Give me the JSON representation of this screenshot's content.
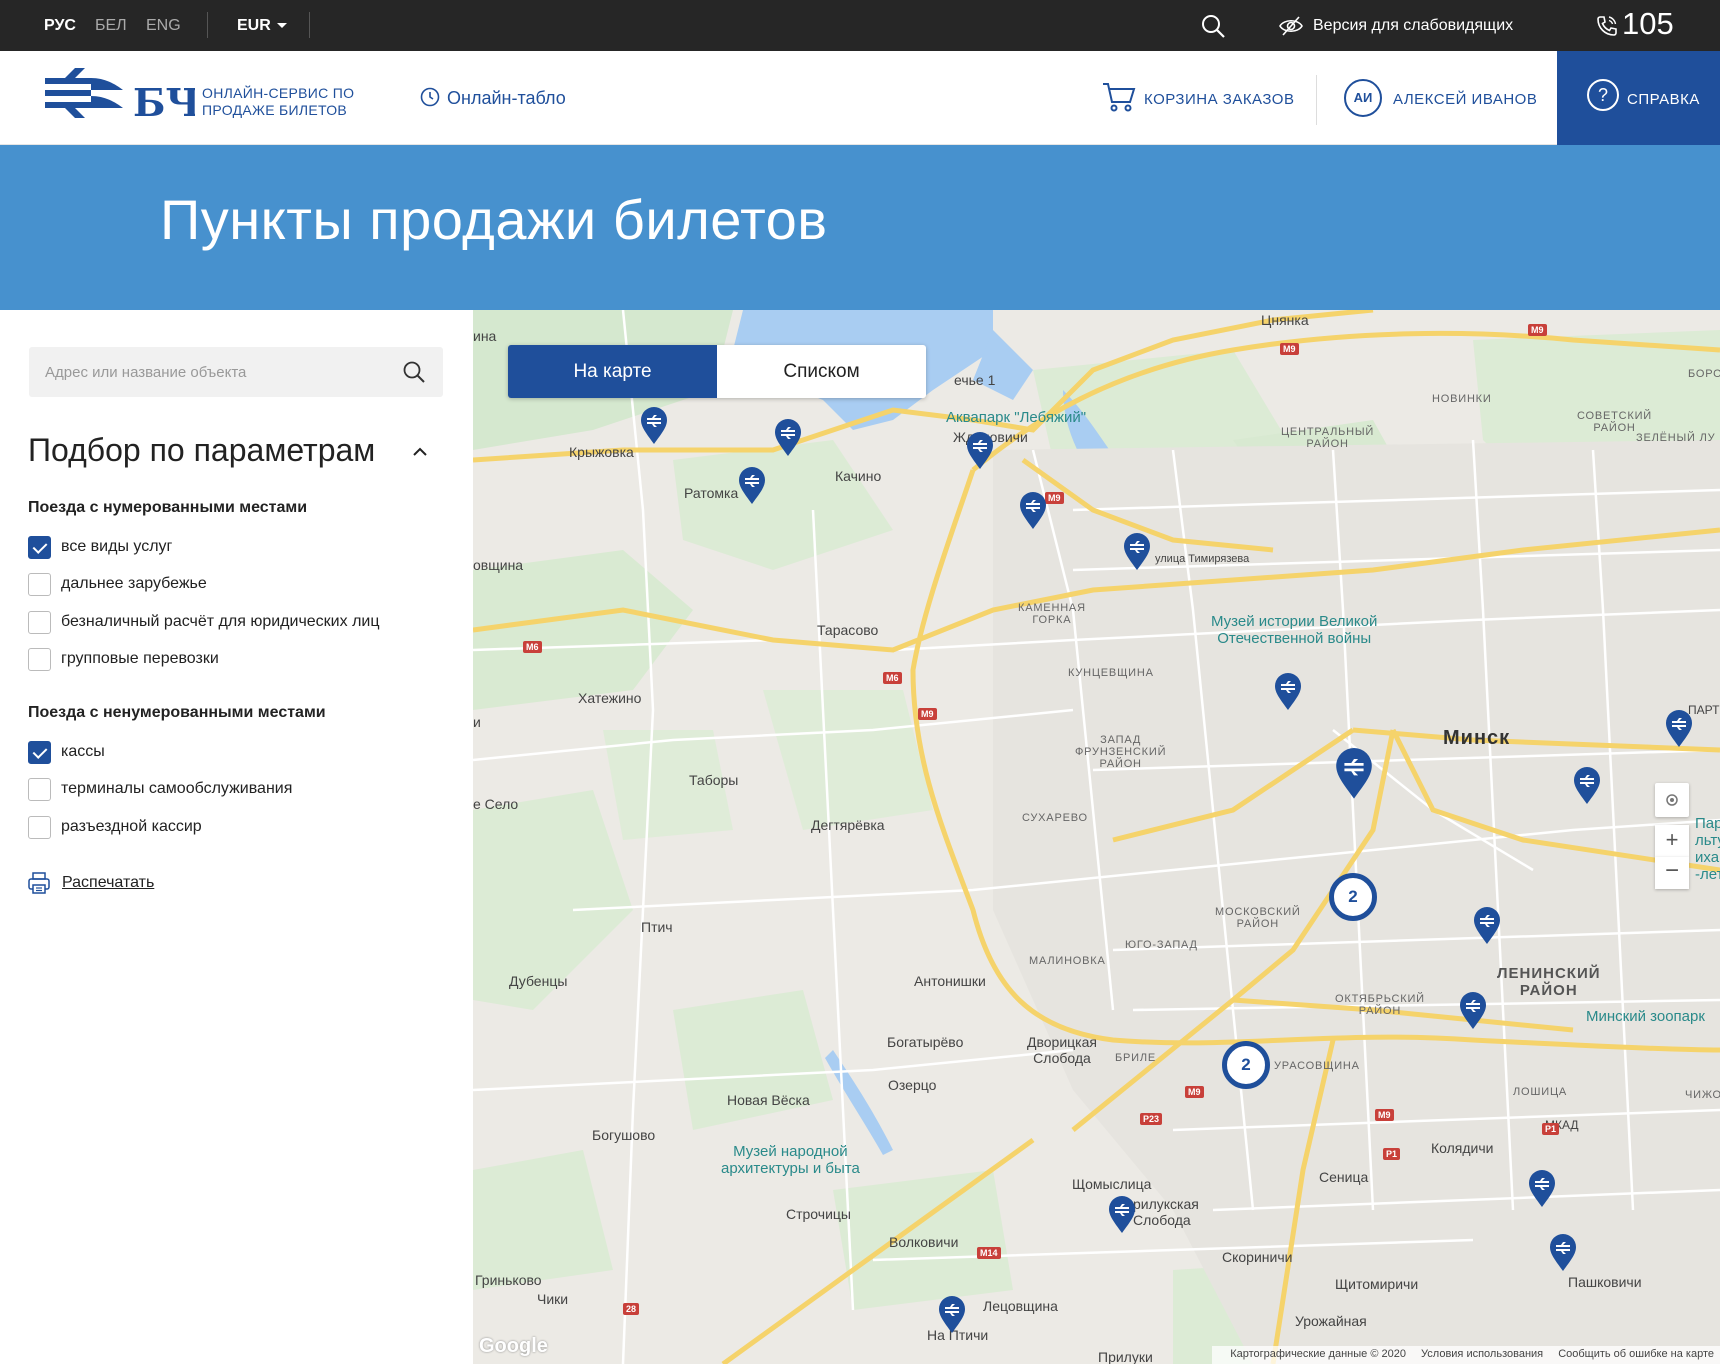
{
  "topbar": {
    "languages": [
      "РУС",
      "БЕЛ",
      "ENG"
    ],
    "currency": "EUR",
    "vision_label": "Версия для слабовидящих",
    "phone": "105"
  },
  "header": {
    "logo_letters": "БЧ",
    "logo_line1": "ОНЛАЙН-СЕРВИС ПО",
    "logo_line2": "ПРОДАЖЕ БИЛЕТОВ",
    "tablo_label": "Онлайн-табло",
    "cart_label": "КОРЗИНА ЗАКАЗОВ",
    "user_initials": "АИ",
    "user_name": "АЛЕКСЕЙ ИВАНОВ",
    "help_label": "СПРАВКА",
    "colors": {
      "brand": "#1f4f9b",
      "banner": "#4791ce"
    }
  },
  "banner": {
    "title": "Пункты продажи билетов"
  },
  "sidebar": {
    "search_placeholder": "Адрес или название объекта",
    "params_title": "Подбор по параметрам",
    "group1": {
      "title": "Поезда с нумерованными местами",
      "options": [
        {
          "label": "все виды услуг",
          "checked": true
        },
        {
          "label": "дальнее зарубежье",
          "checked": false
        },
        {
          "label": "безналичный расчёт для юридических лиц",
          "checked": false
        },
        {
          "label": "групповые перевозки",
          "checked": false
        }
      ]
    },
    "group2": {
      "title": "Поезда с ненумерованными местами",
      "options": [
        {
          "label": "кассы",
          "checked": true
        },
        {
          "label": "терминалы самообслуживания",
          "checked": false
        },
        {
          "label": "разъездной кассир",
          "checked": false
        }
      ]
    },
    "print_label": "Распечатать"
  },
  "map": {
    "view_toggle": {
      "map_label": "На карте",
      "list_label": "Списком",
      "active": "map"
    },
    "labels": {
      "tsnyanka": "Цнянка",
      "krizhovka": "Крыжовка",
      "ratomka": "Ратомка",
      "kachino": "Качино",
      "zhdanovichi": "Ждановичи",
      "aquapark": "Аквапарк \"Лебяжий\"",
      "ochishche": "ечье 1",
      "novinki": "НОВИНКИ",
      "centralny": "ЦЕНТРАЛЬНЫЙ",
      "rayon": "РАЙОН",
      "sovetsky": "СОВЕТСКИЙ",
      "zeleny": "ЗЕЛЁНЫЙ ЛУ",
      "boro": "БОРО",
      "ovshchina": "овщина",
      "tarasovo": "Тарасово",
      "kamennaya": "КАМЕННАЯ",
      "gorka": "ГОРКА",
      "timiryazeva": "улица Тимирязева",
      "museum_war_1": "Музей истории Великой",
      "museum_war_2": "Отечественной войны",
      "khatezhino": "Хатежино",
      "kuntsevshchina": "КУНЦЕВЩИНА",
      "zapad": "ЗАПАД",
      "frunzensky": "ФРУНЗЕНСКИЙ",
      "minsk": "Минск",
      "part": "ПАРТ",
      "tabory": "Таборы",
      "selo": "е Село",
      "degtyarevka": "Дегтярёвка",
      "sukharevo": "СУХАРЕВО",
      "park1": "Пар",
      "park2": "льтур",
      "park3": "иха и",
      "park4": "-лет",
      "ptich": "Птич",
      "moskovsky": "МОСКОВСКИЙ",
      "yugo_zapad": "ЮГО-ЗАПАД",
      "malinovka": "МАЛИНОВКА",
      "leninsky1": "ЛЕНИНСКИЙ",
      "leninsky2": "РАЙОН",
      "dubentsy": "Дубенцы",
      "antonishki": "Антонишки",
      "oktyabrsky": "ОКТЯБРЬСКИЙ",
      "zoo": "Минский зоопарк",
      "bogatyrevo": "Богатырёво",
      "dvorishche1": "Дворицкая",
      "dvorishche2": "Слобода",
      "brilevichi": "БРИЛЕ",
      "urasovshchina": "УРАСОВЩИНА",
      "ozertso": "Озерцо",
      "novaya_veska": "Новая Вёска",
      "loshitsa": "ЛОШИЦА",
      "chizhovka": "ЧИЖО",
      "mkad": "МКАД",
      "bogushovo": "Богушово",
      "museum_arch1": "Музей народной",
      "museum_arch2": "архитектуры и быта",
      "kolyadichi": "Колядичи",
      "senitsa": "Сеница",
      "shchomyslitsa": "Щомыслица",
      "pilukskaya1": "рилукская",
      "pilukskaya2": "Слобода",
      "strochitsy": "Строчицы",
      "volkovichi": "Волковичи",
      "skorinichi": "Скориничи",
      "gritskovo": "Гриньково",
      "chiki": "Чики",
      "shchitomirichi": "Щитомиричи",
      "pashkovichi": "Пашковичи",
      "letsovshchina": "Лецовщина",
      "na_ptichi": "На Птичи",
      "urozhaynaya": "Урожайная",
      "priluki": "Прилуки",
      "i": "и"
    },
    "road_shields": [
      "M9",
      "M9",
      "M6",
      "M6",
      "M9",
      "M9",
      "M9",
      "M9",
      "P1",
      "P23",
      "P1",
      "M14",
      "28"
    ],
    "clusters": [
      "2",
      "2"
    ],
    "zoom_in": "+",
    "zoom_out": "−",
    "attribution": {
      "data": "Картографические данные © 2020",
      "terms": "Условия использования",
      "report": "Сообщить об ошибке на карте",
      "google": "Google"
    }
  }
}
